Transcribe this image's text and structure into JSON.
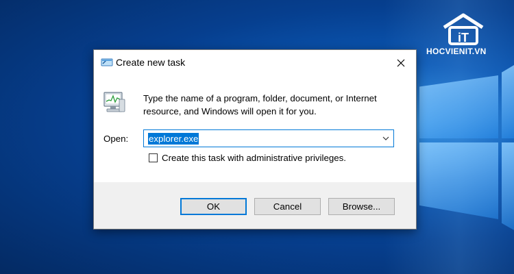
{
  "dialog": {
    "title": "Create new task",
    "description_line1": "Type the name of a program, folder, document, or Internet",
    "description_line2": "resource, and Windows will open it for you.",
    "open_label": "Open:",
    "open_value": "explorer.exe",
    "admin_checkbox_label": "Create this task with administrative privileges.",
    "admin_checked": false,
    "buttons": {
      "ok": "OK",
      "cancel": "Cancel",
      "browse": "Browse..."
    }
  },
  "watermark": {
    "text": "HOCVIENIT.VN",
    "logo_letters": "iT"
  },
  "colors": {
    "accent": "#0078d7",
    "footer_bg": "#f0f0f0",
    "button_bg": "#e1e1e1",
    "desktop_blue": "#0b57b3"
  },
  "icons": [
    "run-icon",
    "close-icon",
    "task-manager-icon",
    "chevron-down-icon",
    "windows-logo",
    "hocvienit-logo"
  ]
}
